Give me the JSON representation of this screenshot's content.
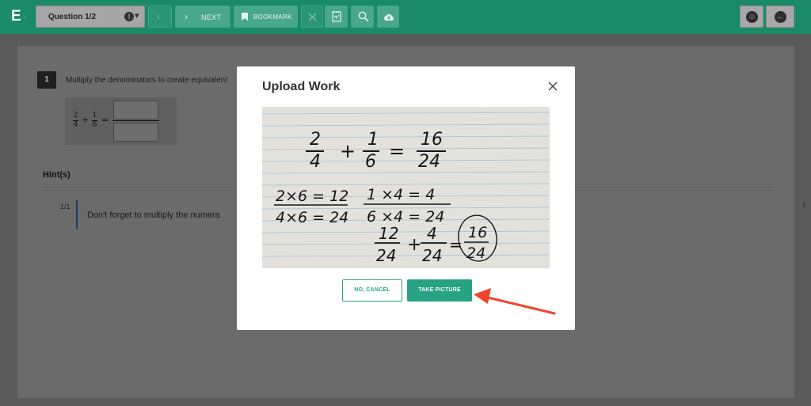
{
  "toolbar": {
    "logo": "E",
    "logo_suffix": "·",
    "question_select": "Question 1/2",
    "next_label": "NEXT",
    "bookmark_label": "BOOKMARK"
  },
  "question": {
    "number": "1",
    "prompt": "Multiply the denominators to create equivalent",
    "math": {
      "frac1_num": "2",
      "frac1_den": "4",
      "plus": "+",
      "frac2_num": "1",
      "frac2_den": "6",
      "equals": "="
    }
  },
  "hints": {
    "title": "Hint(s)",
    "count": "1/1",
    "text": "Don't forget to multiply the numera"
  },
  "modal": {
    "title": "Upload Work",
    "cancel_label": "NO, CANCEL",
    "take_picture_label": "TAKE PICTURE",
    "work_lines": {
      "l1_num": "2",
      "l1_den": "4",
      "l1_plus": "+",
      "l1_num2": "1",
      "l1_den2": "6",
      "l1_eq": "=",
      "l1_num3": "16",
      "l1_den3": "24",
      "l2a_top": "2×6 = 12",
      "l2a_bot": "4×6 = 24",
      "l2b_top": "1 ×4 = 4",
      "l2b_bot": "6 ×4 = 24",
      "l3_num1": "12",
      "l3_den1": "24",
      "l3_plus": "+",
      "l3_num2": "4",
      "l3_den2": "24",
      "l3_eq": "=",
      "l3_num3": "16",
      "l3_den3": "24"
    }
  },
  "colors": {
    "toolbar": "#1b8a67",
    "accent": "#27a383",
    "arrow": "#f0452b"
  }
}
